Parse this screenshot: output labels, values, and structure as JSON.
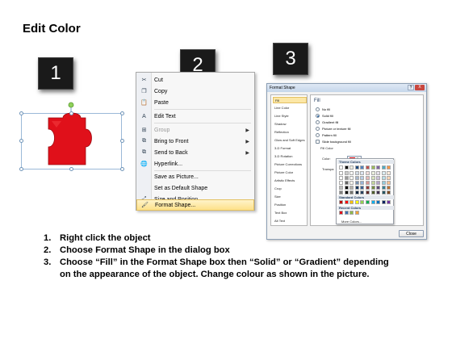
{
  "title": "Edit Color",
  "step_badges": [
    "1",
    "2",
    "3"
  ],
  "puzzle": {
    "fill_color": "#e0101a"
  },
  "context_menu": {
    "items": [
      {
        "label": "Cut",
        "icon": "scissors-icon",
        "disabled": false
      },
      {
        "label": "Copy",
        "icon": "copy-icon",
        "disabled": false
      },
      {
        "label": "Paste",
        "icon": "paste-icon",
        "disabled": false
      },
      {
        "label": "Edit Text",
        "icon": "edit-text-icon",
        "disabled": false
      },
      {
        "label": "Group",
        "icon": "group-icon",
        "disabled": true,
        "submenu": true
      },
      {
        "label": "Bring to Front",
        "icon": "bring-front-icon",
        "disabled": false,
        "submenu": true
      },
      {
        "label": "Send to Back",
        "icon": "send-back-icon",
        "disabled": false,
        "submenu": true
      },
      {
        "label": "Hyperlink...",
        "icon": "hyperlink-icon",
        "disabled": false
      },
      {
        "label": "Save as Picture...",
        "icon": "",
        "disabled": false
      },
      {
        "label": "Set as Default Shape",
        "icon": "",
        "disabled": false
      },
      {
        "label": "Size and Position...",
        "icon": "size-position-icon",
        "disabled": false
      },
      {
        "label": "Format Shape...",
        "icon": "format-shape-icon",
        "disabled": false,
        "highlighted": true
      }
    ]
  },
  "format_dialog": {
    "title": "Format Shape",
    "help": "?",
    "close_x": "X",
    "sidebar": [
      "Fill",
      "Line Color",
      "Line Style",
      "Shadow",
      "Reflection",
      "Glow and Soft Edges",
      "3-D Format",
      "3-D Rotation",
      "Picture Corrections",
      "Picture Color",
      "Artistic Effects",
      "Crop",
      "Size",
      "Position",
      "Text Box",
      "Alt Text"
    ],
    "selected": "Fill",
    "fill_heading": "Fill",
    "fill_options": [
      {
        "label": "No fill",
        "on": false
      },
      {
        "label": "Solid fill",
        "on": true
      },
      {
        "label": "Gradient fill",
        "on": false
      },
      {
        "label": "Picture or texture fill",
        "on": false
      },
      {
        "label": "Pattern fill",
        "on": false
      },
      {
        "label": "Slide background fill",
        "on": false
      }
    ],
    "fill_color_label": "Fill Color",
    "color_label": "Color:",
    "transparency_label": "Transpa",
    "close_button": "Close",
    "palette": {
      "theme_title": "Theme Colors",
      "standard_title": "Standard Colors",
      "recent_title": "Recent Colors",
      "more_colors": "More Colors...",
      "theme_top": [
        "#ffffff",
        "#000000",
        "#eeece1",
        "#1f497d",
        "#4f81bd",
        "#c0504d",
        "#9bbb59",
        "#8064a2",
        "#4bacc6",
        "#f79646"
      ],
      "standard": [
        "#c00000",
        "#ff0000",
        "#ffc000",
        "#ffff00",
        "#92d050",
        "#00b050",
        "#00b0f0",
        "#0070c0",
        "#002060",
        "#7030a0"
      ],
      "recent": [
        "#e0101a",
        "#3f6fb0",
        "#8fb94a",
        "#f2a33a"
      ]
    }
  },
  "instructions": [
    {
      "num": "1.",
      "text": "Right click the object"
    },
    {
      "num": "2.",
      "text": "Choose Format Shape in the dialog box"
    },
    {
      "num": "3.",
      "text": "Choose “Fill” in the Format Shape box then “Solid” or “Gradient” depending on the appearance of the object. Change colour as shown in the picture."
    }
  ]
}
